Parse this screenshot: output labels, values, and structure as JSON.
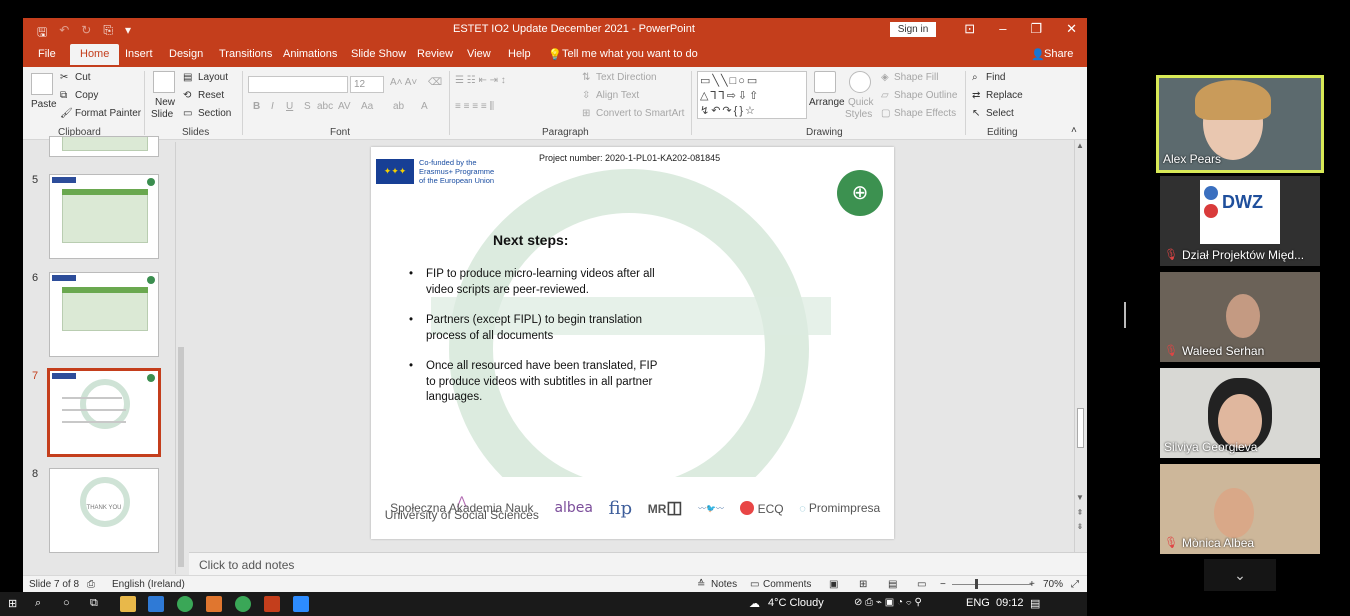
{
  "app": {
    "title": "ESTET IO2 Update December 2021  -  PowerPoint",
    "sign_in": "Sign in",
    "qat": {
      "save_icon": "save-icon",
      "undo_icon": "undo-icon",
      "redo_icon": "redo-icon",
      "present_icon": "present-icon",
      "more_icon": "more-icon"
    },
    "window_controls": {
      "ribbon_options": "⊡",
      "minimize": "‒",
      "restore": "❐",
      "close": "✕"
    }
  },
  "tabs": [
    {
      "label": "File"
    },
    {
      "label": "Home"
    },
    {
      "label": "Insert"
    },
    {
      "label": "Design"
    },
    {
      "label": "Transitions"
    },
    {
      "label": "Animations"
    },
    {
      "label": "Slide Show"
    },
    {
      "label": "Review"
    },
    {
      "label": "View"
    },
    {
      "label": "Help"
    },
    {
      "label": "Tell me what you want to do"
    },
    {
      "label": "Share"
    }
  ],
  "ribbon": {
    "clipboard": {
      "paste": "Paste",
      "cut": "Cut",
      "copy": "Copy",
      "format_painter": "Format Painter",
      "label": "Clipboard"
    },
    "slides": {
      "new_slide": "New",
      "new_slide2": "Slide",
      "layout": "Layout",
      "reset": "Reset",
      "section": "Section",
      "label": "Slides"
    },
    "font": {
      "font_size": "12",
      "label": "Font"
    },
    "paragraph": {
      "text_direction": "Text Direction",
      "align_text": "Align Text",
      "convert_smartart": "Convert to SmartArt",
      "label": "Paragraph"
    },
    "drawing": {
      "arrange": "Arrange",
      "quick_styles": "Quick",
      "quick_styles2": "Styles",
      "shape_fill": "Shape Fill",
      "shape_outline": "Shape Outline",
      "shape_effects": "Shape Effects",
      "label": "Drawing"
    },
    "editing": {
      "find": "Find",
      "replace": "Replace",
      "select": "Select",
      "label": "Editing"
    }
  },
  "thumbnails": [
    {
      "number": "5"
    },
    {
      "number": "6"
    },
    {
      "number": "7"
    },
    {
      "number": "8",
      "text": "THANK YOU"
    }
  ],
  "slide": {
    "eu_text_1": "Co-funded by the",
    "eu_text_2": "Erasmus+ Programme",
    "eu_text_3": "of the European Union",
    "project_number": "Project number: 2020-1-PL01-KA202-081845",
    "title": "Next steps:",
    "bullets": [
      "FIP to produce micro-learning videos after all video scripts are peer-reviewed.",
      "Partners (except FIPL) to begin translation process of all documents",
      "Once all resourced have been translated, FIP to produce videos with subtitles in all partner languages."
    ],
    "partners": {
      "p1a": "Społeczna Akademia Nauk",
      "p1b": "University of Social Sciences",
      "p2": "albea",
      "p3": "fip",
      "p4": "MR",
      "p6": "ECQ",
      "p7": "Promimpresa"
    }
  },
  "notes_placeholder": "Click to add notes",
  "status": {
    "slide": "Slide 7 of 8",
    "language": "English (Ireland)",
    "notes": "Notes",
    "comments": "Comments",
    "zoom": "70%"
  },
  "taskbar": {
    "weather": "4°C  Cloudy",
    "lang": "ENG",
    "time": "09:12"
  },
  "participants": [
    {
      "name": "Alex Pears",
      "muted": false,
      "active": true
    },
    {
      "name": "Dział Projektów Międ...",
      "muted": true,
      "active": false
    },
    {
      "name": "Waleed Serhan",
      "muted": true,
      "active": false
    },
    {
      "name": "Silviya Georgieva",
      "muted": false,
      "active": false
    },
    {
      "name": "Mònica Albea",
      "muted": true,
      "active": false
    }
  ],
  "dwz_logo": "DWZ",
  "colors": {
    "accent": "#c43e1c",
    "active_speaker": "#d9ea57",
    "slide_green": "#3c9150"
  }
}
